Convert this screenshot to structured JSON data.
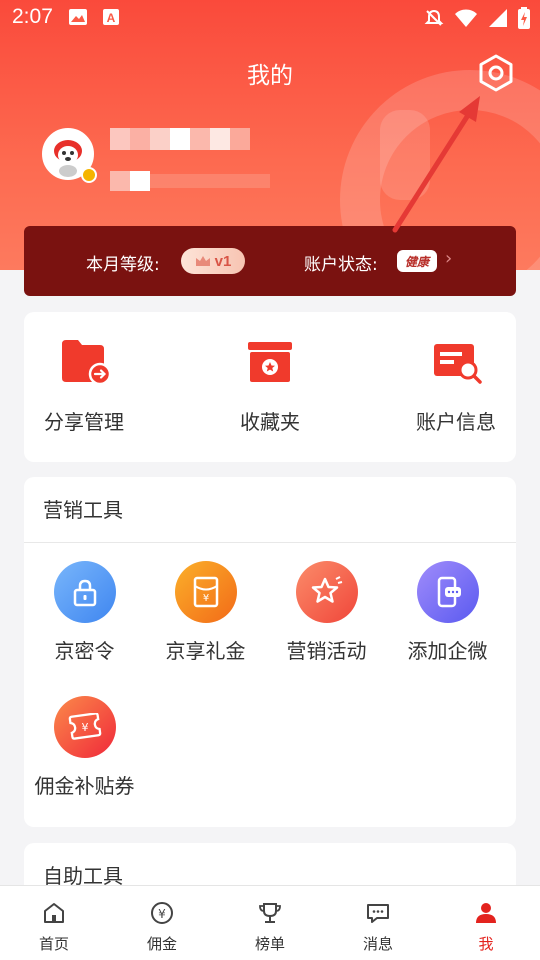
{
  "status_bar": {
    "time": "2:07",
    "icons": [
      "image-icon",
      "a-notification-icon",
      "mute-bell-icon",
      "wifi-icon",
      "battery-icon"
    ]
  },
  "header": {
    "title": "我的",
    "settings_icon": "gear-icon"
  },
  "profile": {
    "avatar_icon": "jd-dog-avatar",
    "badge_color": "#f5b400"
  },
  "level_bar": {
    "level_label": "本月等级:",
    "level_value": "v1",
    "status_label": "账户状态:",
    "status_value": "健康"
  },
  "quick_actions": [
    {
      "label": "分享管理",
      "icon": "share-folder-icon"
    },
    {
      "label": "收藏夹",
      "icon": "favorites-box-icon"
    },
    {
      "label": "账户信息",
      "icon": "account-card-icon"
    }
  ],
  "marketing_tools": {
    "title": "营销工具",
    "items": [
      {
        "label": "京密令",
        "icon": "lock-icon",
        "color": "#4a90f2"
      },
      {
        "label": "京享礼金",
        "icon": "red-envelope-icon",
        "color": "#f7931e"
      },
      {
        "label": "营销活动",
        "icon": "star-icon",
        "color": "#f56a4a"
      },
      {
        "label": "添加企微",
        "icon": "phone-chat-icon",
        "color": "#6c6cf5"
      },
      {
        "label": "佣金补贴券",
        "icon": "coupon-icon",
        "color": "#f2412e"
      }
    ]
  },
  "self_service": {
    "title": "自助工具"
  },
  "bottom_nav": [
    {
      "label": "首页",
      "icon": "home-icon"
    },
    {
      "label": "佣金",
      "icon": "yuan-coin-icon"
    },
    {
      "label": "榜单",
      "icon": "trophy-icon"
    },
    {
      "label": "消息",
      "icon": "message-icon"
    },
    {
      "label": "我",
      "icon": "person-icon",
      "active": true
    }
  ],
  "colors": {
    "brand_red": "#fa4a3b",
    "level_bar_bg": "#7a1210",
    "active_nav": "#e3231e"
  }
}
